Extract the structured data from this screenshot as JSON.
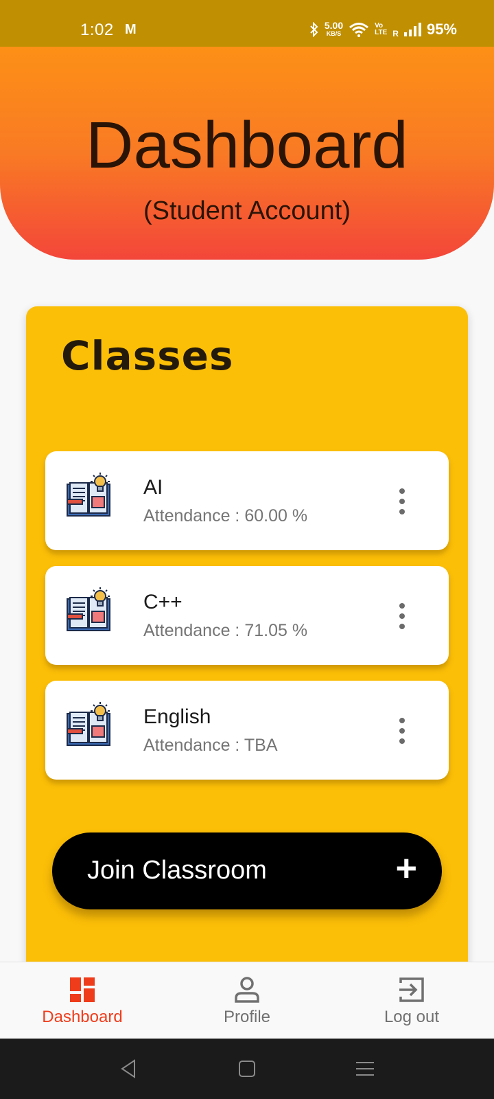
{
  "status_bar": {
    "time": "1:02",
    "carrier_icon": "M",
    "net_speed_value": "5.00",
    "net_speed_unit": "KB/S",
    "volte_top": "Vo",
    "volte_bottom": "LTE",
    "roaming": "R",
    "battery": "95%"
  },
  "header": {
    "title": "Dashboard",
    "subtitle": "(Student Account)",
    "gradient_top": "#fd9016",
    "gradient_bottom": "#f3463a"
  },
  "classes": {
    "title": "Classes",
    "panel_color": "#fcbf07",
    "items": [
      {
        "name": "AI",
        "attendance": "Attendance : 60.00 %",
        "icon": "book-idea-icon"
      },
      {
        "name": "C++",
        "attendance": "Attendance : 71.05 %",
        "icon": "book-idea-icon"
      },
      {
        "name": "English",
        "attendance": "Attendance : TBA",
        "icon": "book-idea-icon"
      }
    ]
  },
  "join_button": {
    "label": "Join Classroom",
    "icon": "+"
  },
  "bottom_nav": {
    "active_color": "#ef3d1c",
    "inactive_color": "#707070",
    "items": [
      {
        "label": "Dashboard",
        "icon": "dashboard-icon",
        "active": true
      },
      {
        "label": "Profile",
        "icon": "person-icon",
        "active": false
      },
      {
        "label": "Log out",
        "icon": "logout-icon",
        "active": false
      }
    ]
  }
}
